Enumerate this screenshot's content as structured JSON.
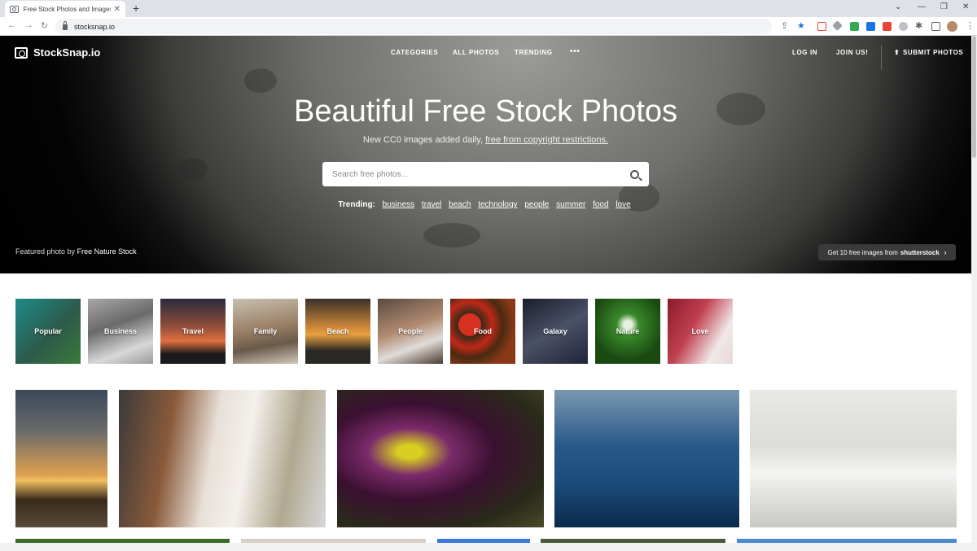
{
  "browser": {
    "tab_title": "Free Stock Photos and Images - StockSnap.io",
    "tab_close": "✕",
    "new_tab": "+",
    "url": "stocksnap.io",
    "win_minimize": "—",
    "win_restore": "❐",
    "win_close": "✕",
    "tab_list": "⌄"
  },
  "site": {
    "brand": "StockSnap.io",
    "nav": {
      "categories": "CATEGORIES",
      "all_photos": "ALL PHOTOS",
      "trending": "TRENDING",
      "more": "•••",
      "log_in": "LOG IN",
      "join": "JOIN US!",
      "submit": "SUBMIT PHOTOS"
    }
  },
  "hero": {
    "title": "Beautiful Free Stock Photos",
    "subtitle_text": "New CC0 images added daily,",
    "subtitle_link": "free from copyright restrictions.",
    "search_placeholder": "Search free photos...",
    "trending_label": "Trending:",
    "trending_tags": [
      "business",
      "travel",
      "beach",
      "technology",
      "people",
      "summer",
      "food",
      "love"
    ],
    "credit_prefix": "Featured photo by",
    "credit_author": "Free Nature Stock",
    "promo_text": "Get 10 free images from",
    "promo_brand": "shutterstock",
    "promo_chevron": "›"
  },
  "categories": [
    {
      "label": "Popular",
      "color": "#2a6b6a"
    },
    {
      "label": "Business",
      "color": "#8b8b8b"
    },
    {
      "label": "Travel",
      "color": "#b2533a"
    },
    {
      "label": "Family",
      "color": "#a89479"
    },
    {
      "label": "Beach",
      "color": "#6e5a3a"
    },
    {
      "label": "People",
      "color": "#7a5b4d"
    },
    {
      "label": "Food",
      "color": "#7a3b1e"
    },
    {
      "label": "Galaxy",
      "color": "#3a3d52"
    },
    {
      "label": "Nature",
      "color": "#2d6a1f"
    },
    {
      "label": "Love",
      "color": "#9a2a3a"
    }
  ],
  "photos": [
    {
      "subject": "palm tree sunset"
    },
    {
      "subject": "woman reading book"
    },
    {
      "subject": "purple flower"
    },
    {
      "subject": "blue water"
    },
    {
      "subject": "couple pillow fight"
    }
  ],
  "colors": {
    "accent": "#ffffff",
    "hero_bg": "#000000"
  }
}
